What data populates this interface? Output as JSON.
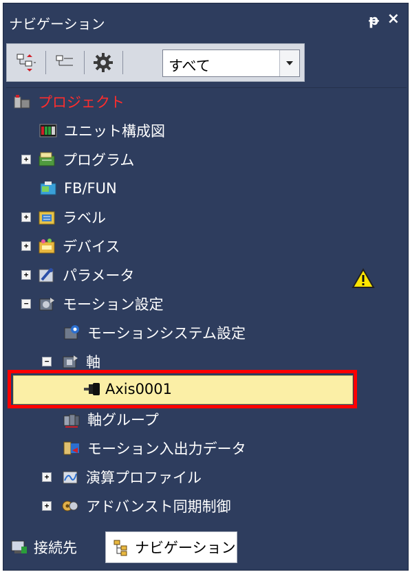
{
  "window": {
    "title": "ナビゲーション",
    "pin_glyph": "ᵽ",
    "close_glyph": "×"
  },
  "toolbar": {
    "filter_value": "すべて",
    "icons": [
      "expand-tree-icon",
      "collapse-tree-icon",
      "gear-icon",
      "chevron-down-icon"
    ]
  },
  "tree": {
    "root": "プロジェクト",
    "items": [
      {
        "label": "ユニット構成図",
        "icon": "unit-config-icon"
      },
      {
        "label": "プログラム",
        "icon": "program-icon",
        "expander": "+"
      },
      {
        "label": "FB/FUN",
        "icon": "fbfun-icon"
      },
      {
        "label": "ラベル",
        "icon": "label-icon",
        "expander": "+"
      },
      {
        "label": "デバイス",
        "icon": "device-icon",
        "expander": "+"
      },
      {
        "label": "パラメータ",
        "icon": "parameter-icon",
        "expander": "+",
        "warning": true
      },
      {
        "label": "モーション設定",
        "icon": "motion-icon",
        "expander": "−"
      },
      {
        "label": "モーションシステム設定",
        "icon": "motion-system-icon"
      },
      {
        "label": "軸",
        "icon": "axis-folder-icon",
        "expander": "−"
      },
      {
        "label": "Axis0001",
        "icon": "axis-item-icon",
        "selected": true
      },
      {
        "label": "軸グループ",
        "icon": "axis-group-icon"
      },
      {
        "label": "モーション入出力データ",
        "icon": "motion-io-icon"
      },
      {
        "label": "演算プロファイル",
        "icon": "calc-profile-icon",
        "expander": "+"
      },
      {
        "label": "アドバンスト同期制御",
        "icon": "advanced-sync-icon",
        "expander": "+"
      }
    ]
  },
  "bottom_tabs": [
    {
      "label": "接続先",
      "active": false
    },
    {
      "label": "ナビゲーション",
      "active": true
    }
  ],
  "colors": {
    "panel_bg": "#2e3d5e",
    "root_text": "#ff2d2d",
    "selected_bg": "#fbefa6",
    "highlight_frame": "#ff0000",
    "warning": "#ffe600"
  }
}
